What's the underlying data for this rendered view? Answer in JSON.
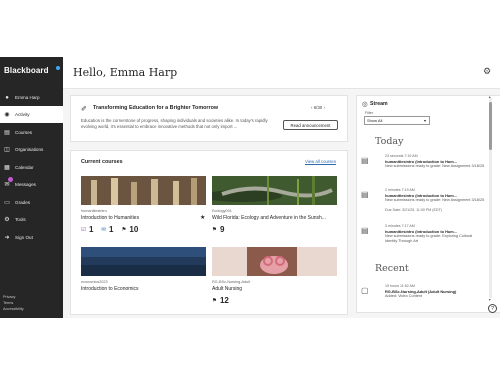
{
  "app": {
    "logo": "Blackboard"
  },
  "header": {
    "greeting": "Hello, Emma Harp"
  },
  "sidebar": {
    "items": [
      {
        "label": "Emma Harp",
        "icon": "user-icon"
      },
      {
        "label": "Activity",
        "icon": "activity-icon",
        "active": true
      },
      {
        "label": "Courses",
        "icon": "courses-icon"
      },
      {
        "label": "Organisations",
        "icon": "organisations-icon"
      },
      {
        "label": "Calendar",
        "icon": "calendar-icon"
      },
      {
        "label": "Messages",
        "icon": "messages-icon",
        "badge": true
      },
      {
        "label": "Grades",
        "icon": "grades-icon"
      },
      {
        "label": "Tools",
        "icon": "tools-icon"
      },
      {
        "label": "Sign Out",
        "icon": "sign-out-icon"
      }
    ],
    "footer": [
      "Privacy",
      "Terms",
      "Accessibility"
    ]
  },
  "announcement": {
    "title": "Transforming Education for a Brighter Tomorrow",
    "pager": "6/30",
    "text": "Education is the cornerstone of progress, shaping individuals and societies alike. In today's rapidly evolving world, it's essential to embrace innovative methods that not only import ...",
    "button": "Read announcement"
  },
  "courses": {
    "title": "Current courses",
    "view_all": "View all courses",
    "tiles": [
      {
        "code": "humanitiesintro",
        "name": "Introduction to Humanities",
        "stats": [
          "1",
          "1",
          "10"
        ],
        "starred": true,
        "color": "#8a6e4b"
      },
      {
        "code": "Ecology001",
        "name": "Wild Florida: Ecology and Adventure in the Sunsh...",
        "stats": [
          "9"
        ],
        "color": "#4f6b3a"
      },
      {
        "code": "economics2023",
        "name": "Introduction to Economics",
        "stats": [],
        "color": "#2f4a6e"
      },
      {
        "code": "RG-BSc-Nursing-Adult",
        "name": "Adult Nursing",
        "stats": [
          "12"
        ],
        "color": "#c98f8c"
      }
    ]
  },
  "stream": {
    "title": "Stream",
    "filter_label": "Filter",
    "filter_value": "Show All",
    "today_label": "Today",
    "recent_label": "Recent",
    "items": [
      {
        "time": "23 seconds 7:19 AM",
        "course": "humanitiesintro (Introduction to Hum...",
        "message": "New submissions ready to grade: New Assignment 3/18/25",
        "due": ""
      },
      {
        "time": "2 minutes 7:19 AM",
        "course": "humanitiesintro (Introduction to Hum...",
        "message": "New submissions ready to grade: New Assignment 3/18/25",
        "due": "Due Date: 3/21/25, 11:00 PM (EDT)"
      },
      {
        "time": "3 minutes 7:17 AM",
        "course": "humanitiesintro (Introduction to Hum...",
        "message": "New submissions ready to grade: Exploring Cultural Identity Through Art",
        "due": ""
      },
      {
        "time": "19 hours 11:52 AM",
        "course": "RG-BSc-Nursing-Adult (Adult Nursing)",
        "message": "Added: Video Content",
        "due": ""
      }
    ]
  }
}
